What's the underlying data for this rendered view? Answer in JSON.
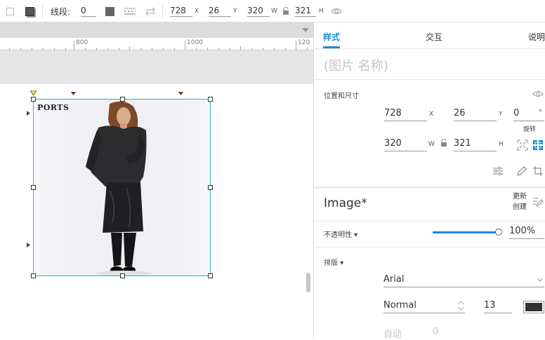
{
  "toolbar": {
    "segment_label": "线段:",
    "segment_value": "0",
    "x_value": "728",
    "x_unit": "X",
    "y_value": "26",
    "y_unit": "Y",
    "w_value": "320",
    "w_unit": "W",
    "h_value": "321",
    "h_unit": "H"
  },
  "ruler": {
    "ticks": [
      "800",
      "1000",
      "120"
    ]
  },
  "canvas": {
    "image_brand_text": "PORTS"
  },
  "panel": {
    "tabs": [
      {
        "label": "样式",
        "active": true
      },
      {
        "label": "交互",
        "active": false
      },
      {
        "label": "说明",
        "active": false
      }
    ],
    "name_placeholder": "(图片 名称)",
    "position_section_label": "位置和尺寸",
    "x_value": "728",
    "x_unit": "X",
    "y_value": "26",
    "y_unit": "Y",
    "rotation_value": "0",
    "rotation_unit": "°",
    "rotation_label": "旋转",
    "w_value": "320",
    "w_unit": "W",
    "h_value": "321",
    "h_unit": "H",
    "style_name": "Image*",
    "style_update": "更新",
    "style_create": "创建",
    "opacity_label": "不透明性 ▾",
    "opacity_value": "100%",
    "opacity_fraction": 1.0,
    "typography_label": "排版 ▾",
    "font_family": "Arial",
    "font_weight": "Normal",
    "font_size": "13",
    "font_color": "#333333",
    "line_spacing_label": "自动",
    "letter_spacing_value": "0"
  },
  "colors": {
    "accent": "#1a8ad6",
    "selection": "#2bb3c0"
  }
}
